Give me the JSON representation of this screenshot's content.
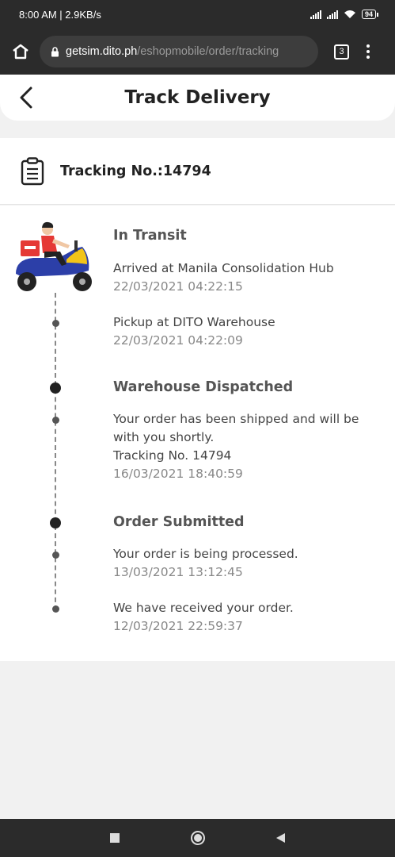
{
  "status_bar": {
    "time_speed": "8:00 AM | 2.9KB/s",
    "battery": "94"
  },
  "browser": {
    "url_host": "getsim.dito.ph",
    "url_path": "/eshopmobile/order/tracking",
    "tab_count": "3"
  },
  "header": {
    "title": "Track Delivery"
  },
  "tracking": {
    "label": "Tracking No.:14794"
  },
  "timeline": {
    "sections": [
      {
        "title": "In Transit",
        "events": [
          {
            "text": "Arrived at Manila Consolidation Hub",
            "timestamp": "22/03/2021 04:22:15"
          },
          {
            "text": "Pickup at DITO Warehouse",
            "timestamp": "22/03/2021 04:22:09"
          }
        ]
      },
      {
        "title": "Warehouse Dispatched",
        "events": [
          {
            "text": "Your order has been shipped and will be with you shortly.",
            "extra": "Tracking No. 14794",
            "timestamp": "16/03/2021 18:40:59"
          }
        ]
      },
      {
        "title": "Order Submitted",
        "events": [
          {
            "text": "Your order is being processed.",
            "timestamp": "13/03/2021 13:12:45"
          },
          {
            "text": "We have received your order.",
            "timestamp": "12/03/2021 22:59:37"
          }
        ]
      }
    ]
  },
  "icons": {
    "home": "home-icon",
    "lock": "lock-icon",
    "back": "chevron-left-icon",
    "clipboard": "clipboard-icon",
    "rider": "delivery-rider-icon"
  },
  "colors": {
    "scooter_blue": "#2c3fa8",
    "scooter_yellow": "#f2c418",
    "accent_red": "#e53935"
  }
}
